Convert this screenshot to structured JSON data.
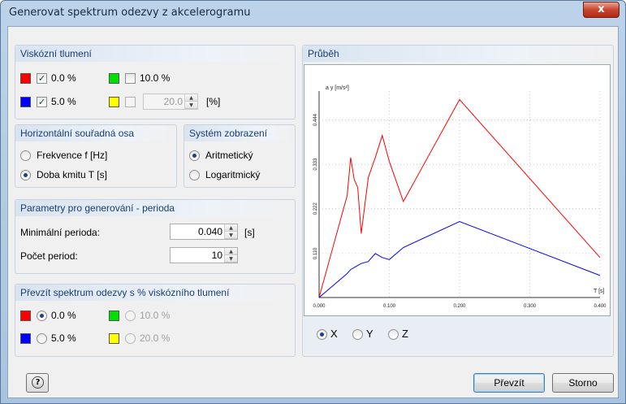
{
  "window": {
    "title": "Generovat spektrum odezvy z akcelerogramu",
    "close": "x"
  },
  "damping": {
    "title": "Viskózní tlumení",
    "items": [
      {
        "color": "#ff0000",
        "checked": true,
        "label": "0.0 %",
        "enabled": true
      },
      {
        "color": "#00e000",
        "checked": false,
        "label": "10.0 %",
        "enabled": true
      },
      {
        "color": "#0000ff",
        "checked": true,
        "label": "5.0 %",
        "enabled": true
      },
      {
        "color": "#ffff00",
        "checked": false,
        "value": "20.0",
        "unit": "[%]",
        "enabled": false
      }
    ]
  },
  "axis": {
    "title": "Horizontální souřadná osa",
    "options": [
      "Frekvence f [Hz]",
      "Doba kmitu T [s]"
    ],
    "selected": 1
  },
  "display": {
    "title": "Systém zobrazení",
    "options": [
      "Aritmetický",
      "Logaritmický"
    ],
    "selected": 0
  },
  "params": {
    "title": "Parametry pro generování - perioda",
    "min_label": "Minimální perioda:",
    "min_value": "0.040",
    "min_unit": "[s]",
    "count_label": "Počet period:",
    "count_value": "10"
  },
  "take": {
    "title": "Převzít spektrum odezvy s % viskózního tlumení",
    "items": [
      {
        "color": "#ff0000",
        "label": "0.0 %",
        "selected": true,
        "enabled": true
      },
      {
        "color": "#00e000",
        "label": "10.0 %",
        "selected": false,
        "enabled": false
      },
      {
        "color": "#0000ff",
        "label": "5.0 %",
        "selected": false,
        "enabled": true
      },
      {
        "color": "#ffff00",
        "label": "20.0 %",
        "selected": false,
        "enabled": false
      }
    ]
  },
  "chart_panel": {
    "title": "Průběh",
    "dirs": [
      "X",
      "Y",
      "Z"
    ],
    "selected_dir": 0
  },
  "chart_data": {
    "type": "line",
    "ylabel": "a y [m/s²]",
    "xlabel": "T [s]",
    "xlim": [
      0.0,
      0.4
    ],
    "xticks": [
      "0.000",
      "0.100",
      "0.200",
      "0.300",
      "0.400"
    ],
    "yticks": [
      "0.110",
      "0.222",
      "0.333",
      "0.444"
    ],
    "series": [
      {
        "color": "#ff0000",
        "points": [
          [
            0.0,
            0.0
          ],
          [
            0.04,
            0.255
          ],
          [
            0.045,
            0.35
          ],
          [
            0.05,
            0.295
          ],
          [
            0.055,
            0.275
          ],
          [
            0.06,
            0.16
          ],
          [
            0.07,
            0.3
          ],
          [
            0.08,
            0.35
          ],
          [
            0.09,
            0.405
          ],
          [
            0.1,
            0.34
          ],
          [
            0.12,
            0.24
          ],
          [
            0.2,
            0.495
          ],
          [
            0.4,
            0.1
          ]
        ]
      },
      {
        "color": "#0000ff",
        "points": [
          [
            0.0,
            0.0
          ],
          [
            0.04,
            0.06
          ],
          [
            0.045,
            0.07
          ],
          [
            0.05,
            0.075
          ],
          [
            0.055,
            0.08
          ],
          [
            0.06,
            0.085
          ],
          [
            0.07,
            0.09
          ],
          [
            0.08,
            0.11
          ],
          [
            0.09,
            0.1
          ],
          [
            0.1,
            0.095
          ],
          [
            0.12,
            0.125
          ],
          [
            0.2,
            0.19
          ],
          [
            0.4,
            0.055
          ]
        ]
      }
    ]
  },
  "buttons": {
    "ok": "Převzít",
    "cancel": "Storno",
    "help": "?"
  }
}
